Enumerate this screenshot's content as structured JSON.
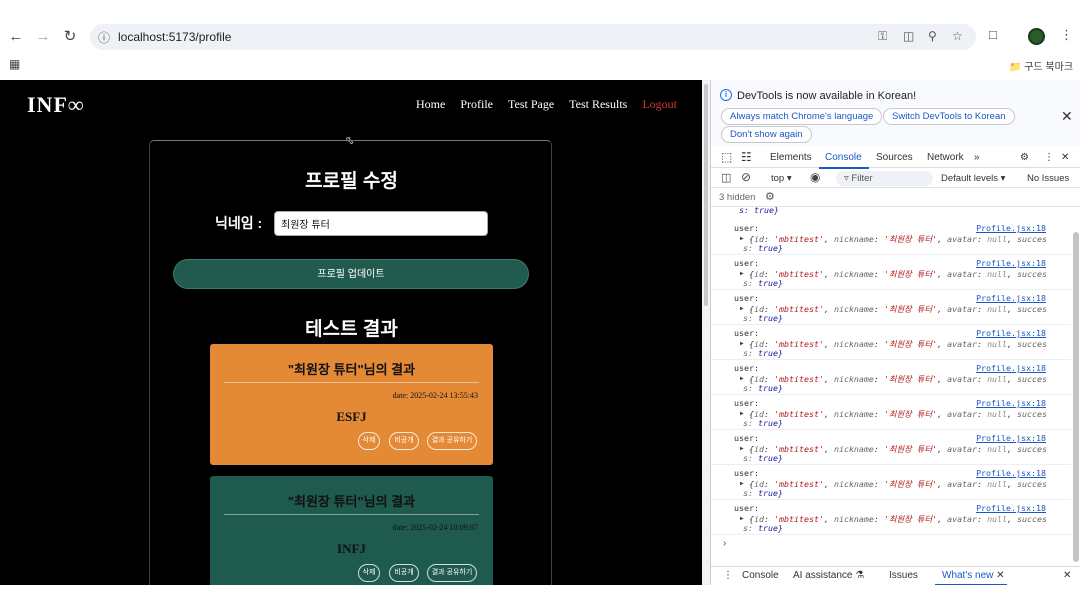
{
  "browser": {
    "url": "localhost:5173/profile",
    "bookmark_folder": "구드 북마크"
  },
  "site": {
    "logo": "INF∞",
    "nav": [
      "Home",
      "Profile",
      "Test Page",
      "Test Results",
      "Logout"
    ]
  },
  "profile": {
    "title": "프로필 수정",
    "nickname_label": "닉네임 :",
    "nickname_value": "최원장 튜터",
    "update_button": "프로필 업데이트",
    "results_title": "테스트 결과"
  },
  "results": [
    {
      "heading": "\"최원장 튜터\"님의 결과",
      "date": "date: 2025-02-24 13:55:43",
      "type": "ESFJ",
      "color": "#e48a36",
      "buttons": [
        "삭제",
        "비공개",
        "결과 공유하기"
      ]
    },
    {
      "heading": "\"최원장 튜터\"님의 결과",
      "date": "date: 2025-02-24 10:09:07",
      "type": "INFJ",
      "color": "#1e5a4d",
      "buttons": [
        "삭제",
        "비공개",
        "결과 공유하기"
      ]
    }
  ],
  "devtools": {
    "info": "DevTools is now available in Korean!",
    "info_buttons": [
      "Always match Chrome's language",
      "Switch DevTools to Korean",
      "Don't show again"
    ],
    "tabs": [
      "Elements",
      "Console",
      "Sources",
      "Network"
    ],
    "context": "top",
    "filter_placeholder": "Filter",
    "levels": "Default levels",
    "issues": "No Issues",
    "hidden": "3 hidden",
    "truncated": "s: true}",
    "log_label": "user:",
    "log_source": "Profile.jsx:18",
    "log_id": "'mbtitest'",
    "log_nickname": "'최원장 튜터'",
    "log_avatar": "null",
    "log_succes": "succes",
    "log_s": "s:",
    "log_true": "true}",
    "drawer_tabs": [
      "Console",
      "AI assistance",
      "Issues",
      "What's new"
    ]
  }
}
